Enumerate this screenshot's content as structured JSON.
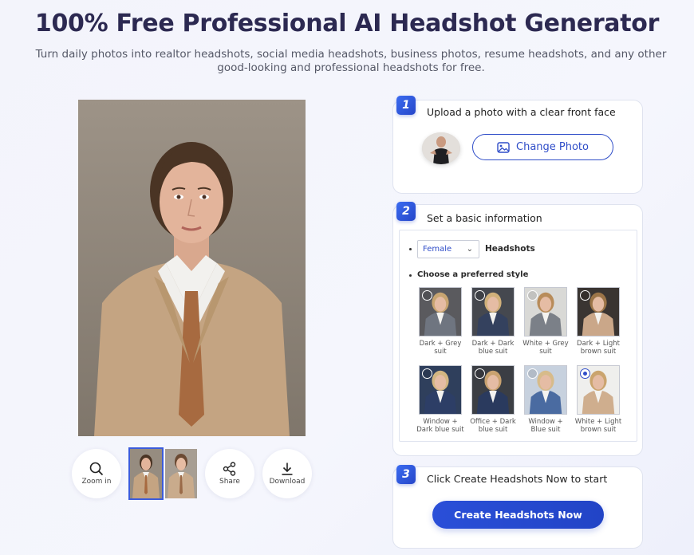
{
  "header": {
    "title": "100% Free Professional AI Headshot Generator",
    "subtitle": "Turn daily photos into realtor headshots, social media headshots, business photos, resume headshots, and any other good-looking and professional headshots for free."
  },
  "tools": {
    "zoom_label": "Zoom in",
    "share_label": "Share",
    "download_label": "Download"
  },
  "step1": {
    "number": "1",
    "title": "Upload a photo with a clear front face",
    "change_button": "Change Photo"
  },
  "step2": {
    "number": "2",
    "title": "Set a basic information",
    "gender_selected": "Female",
    "headshots_label": "Headshots",
    "style_label": "Choose a preferred style",
    "styles": [
      {
        "line1": "Dark + Grey",
        "line2": "suit"
      },
      {
        "line1": "Dark + Dark",
        "line2": "blue suit"
      },
      {
        "line1": "White + Grey",
        "line2": "suit"
      },
      {
        "line1": "Dark + Light",
        "line2": "brown suit"
      },
      {
        "line1": "Window +",
        "line2": "Dark blue suit"
      },
      {
        "line1": "Office + Dark",
        "line2": "blue suit"
      },
      {
        "line1": "Window +",
        "line2": "Blue suit"
      },
      {
        "line1": "White + Light",
        "line2": "brown suit"
      }
    ],
    "selected_style_index": 7
  },
  "step3": {
    "number": "3",
    "title": "Click Create Headshots Now to start",
    "create_button": "Create Headshots Now"
  },
  "colors": {
    "accent": "#2f4dc8",
    "title": "#2c2951"
  }
}
